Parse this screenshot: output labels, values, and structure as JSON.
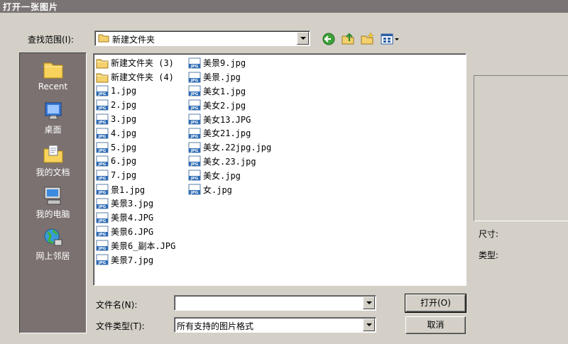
{
  "window": {
    "title": "打开一张图片"
  },
  "look_in": {
    "label": "查找范围(I):",
    "value": "新建文件夹"
  },
  "toolbar": {
    "back_icon": "back-arrow-icon",
    "up_icon": "up-folder-icon",
    "new_folder_icon": "new-folder-icon",
    "views_icon": "views-menu-icon"
  },
  "places": [
    {
      "label": "Recent",
      "icon": "recent-icon"
    },
    {
      "label": "桌面",
      "icon": "desktop-icon"
    },
    {
      "label": "我的文档",
      "icon": "my-documents-icon"
    },
    {
      "label": "我的电脑",
      "icon": "my-computer-icon"
    },
    {
      "label": "网上邻居",
      "icon": "network-icon"
    }
  ],
  "files": {
    "column1": [
      {
        "name": "新建文件夹 (3)",
        "type": "folder"
      },
      {
        "name": "新建文件夹 (4)",
        "type": "folder"
      },
      {
        "name": "1.jpg",
        "type": "jpg"
      },
      {
        "name": "2.jpg",
        "type": "jpg"
      },
      {
        "name": "3.jpg",
        "type": "jpg"
      },
      {
        "name": "4.jpg",
        "type": "jpg"
      },
      {
        "name": "5.jpg",
        "type": "jpg"
      },
      {
        "name": "6.jpg",
        "type": "jpg"
      },
      {
        "name": "7.jpg",
        "type": "jpg"
      },
      {
        "name": "景1.jpg",
        "type": "jpg"
      },
      {
        "name": "美景3.jpg",
        "type": "jpg"
      },
      {
        "name": "美景4.JPG",
        "type": "jpg"
      },
      {
        "name": "美景6.JPG",
        "type": "jpg"
      },
      {
        "name": "美景6_副本.JPG",
        "type": "jpg"
      },
      {
        "name": "美景7.jpg",
        "type": "jpg"
      }
    ],
    "column2": [
      {
        "name": "美景9.jpg",
        "type": "jpg"
      },
      {
        "name": "美景.jpg",
        "type": "jpg"
      },
      {
        "name": "美女1.jpg",
        "type": "jpg"
      },
      {
        "name": "美女2.jpg",
        "type": "jpg"
      },
      {
        "name": "美女13.JPG",
        "type": "jpg"
      },
      {
        "name": "美女21.jpg",
        "type": "jpg"
      },
      {
        "name": "美女.22jpg.jpg",
        "type": "jpg"
      },
      {
        "name": "美女.23.jpg",
        "type": "jpg"
      },
      {
        "name": "美女.jpg",
        "type": "jpg"
      },
      {
        "name": "女.jpg",
        "type": "jpg"
      }
    ]
  },
  "preview": {
    "size_label": "尺寸:",
    "type_label": "类型:"
  },
  "filename": {
    "label": "文件名(N):",
    "value": ""
  },
  "filetype": {
    "label": "文件类型(T):",
    "value": "所有支持的图片格式"
  },
  "buttons": {
    "open": "打开(O)",
    "cancel": "取消"
  },
  "colors": {
    "places_bg": "#7b7170",
    "titlebar": "#7b7474",
    "dialog_bg": "#d4d0c8"
  }
}
